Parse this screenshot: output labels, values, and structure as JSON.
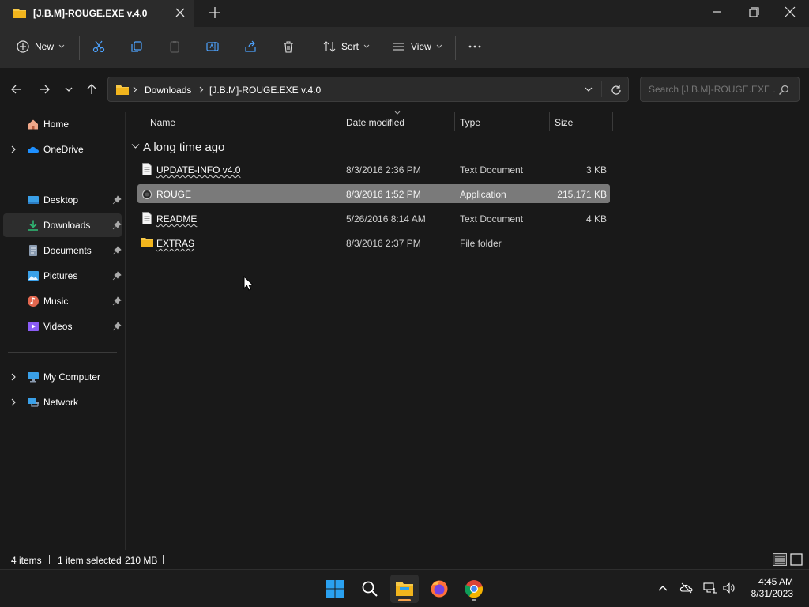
{
  "window": {
    "tab_title": "[J.B.M]-ROUGE.EXE v.4.0"
  },
  "toolbar": {
    "new_label": "New",
    "sort_label": "Sort",
    "view_label": "View"
  },
  "address": {
    "crumbs": [
      "Downloads",
      "[J.B.M]-ROUGE.EXE v.4.0"
    ]
  },
  "search": {
    "placeholder": "Search [J.B.M]-ROUGE.EXE ..."
  },
  "sidebar": {
    "items": [
      {
        "label": "Home",
        "icon": "home-icon"
      },
      {
        "label": "OneDrive",
        "icon": "onedrive-icon"
      },
      {
        "label": "Desktop",
        "icon": "desktop-icon"
      },
      {
        "label": "Downloads",
        "icon": "downloads-icon"
      },
      {
        "label": "Documents",
        "icon": "documents-icon"
      },
      {
        "label": "Pictures",
        "icon": "pictures-icon"
      },
      {
        "label": "Music",
        "icon": "music-icon"
      },
      {
        "label": "Videos",
        "icon": "videos-icon"
      },
      {
        "label": "My Computer",
        "icon": "computer-icon"
      },
      {
        "label": "Network",
        "icon": "network-icon"
      }
    ]
  },
  "columns": {
    "name": "Name",
    "date": "Date modified",
    "type": "Type",
    "size": "Size"
  },
  "group": {
    "title": "A long time ago"
  },
  "files": [
    {
      "name": "UPDATE-INFO v4.0",
      "date": "8/3/2016 2:36 PM",
      "type": "Text Document",
      "size": "3 KB"
    },
    {
      "name": "ROUGE",
      "date": "8/3/2016 1:52 PM",
      "type": "Application",
      "size": "215,171 KB"
    },
    {
      "name": "README",
      "date": "5/26/2016 8:14 AM",
      "type": "Text Document",
      "size": "4 KB"
    },
    {
      "name": "EXTRAS",
      "date": "8/3/2016 2:37 PM",
      "type": "File folder",
      "size": ""
    }
  ],
  "status": {
    "items_count": "4 items",
    "selected": "1 item selected",
    "selected_size": "210 MB"
  },
  "clock": {
    "time": "4:45 AM",
    "date": "8/31/2023"
  },
  "colors": {
    "accent": "#0078d4",
    "folder": "#f7c948",
    "selection": "#7a7a7a"
  }
}
